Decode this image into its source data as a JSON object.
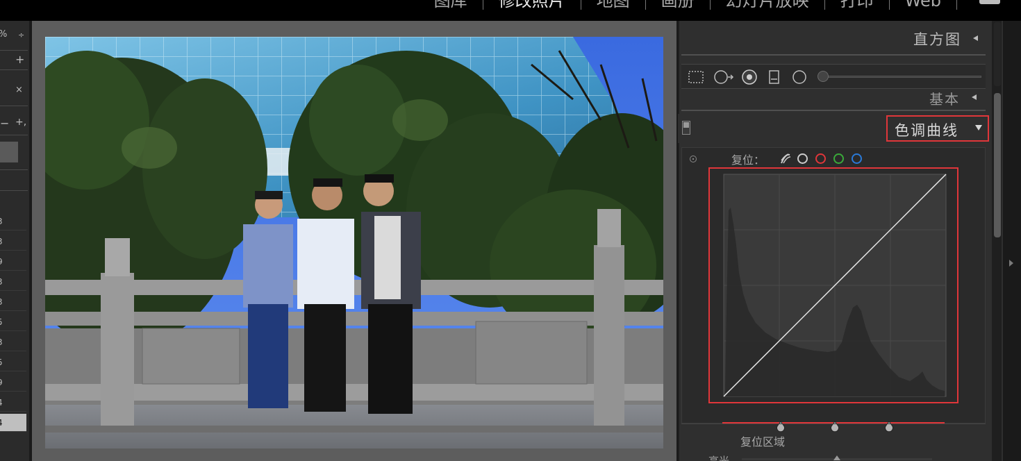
{
  "top_bar": {
    "modules": [
      {
        "label": "图库",
        "active": false
      },
      {
        "label": "修改照片",
        "active": true
      },
      {
        "label": "地图",
        "active": false
      },
      {
        "label": "画册",
        "active": false
      },
      {
        "label": "幻灯片放映",
        "active": false
      },
      {
        "label": "打印",
        "active": false
      },
      {
        "label": "Web",
        "active": false
      }
    ]
  },
  "left_panel": {
    "glyphs": [
      "%",
      "÷",
      "+",
      "×",
      "−",
      "+,"
    ],
    "numbers": [
      "3",
      "3",
      "9",
      "3",
      "3",
      "5",
      "3",
      "5",
      "9",
      "4",
      "4"
    ],
    "selected_index": 10
  },
  "right_panel": {
    "histogram_title": "直方图",
    "tools": [
      "crop-overlay-icon",
      "spot-removal-icon",
      "red-eye-icon",
      "graduated-filter-icon",
      "radial-filter-icon",
      "adjustment-brush-icon"
    ],
    "basic_title": "基本",
    "tone_curve": {
      "title": "色调曲线",
      "reset_label": "复位：",
      "channels": [
        {
          "name": "point-curve-icon",
          "color": "#cccccc"
        },
        {
          "name": "rgb-channel",
          "color": "#cccccc"
        },
        {
          "name": "red-channel",
          "color": "#e0363a"
        },
        {
          "name": "green-channel",
          "color": "#3aaa3a"
        },
        {
          "name": "blue-channel",
          "color": "#2a7ad8"
        }
      ],
      "split_points": [
        0.25,
        0.5,
        0.75
      ],
      "highlight_color": "#e0363a"
    },
    "region": {
      "title": "复位区域",
      "highlights_label": "高光"
    }
  }
}
